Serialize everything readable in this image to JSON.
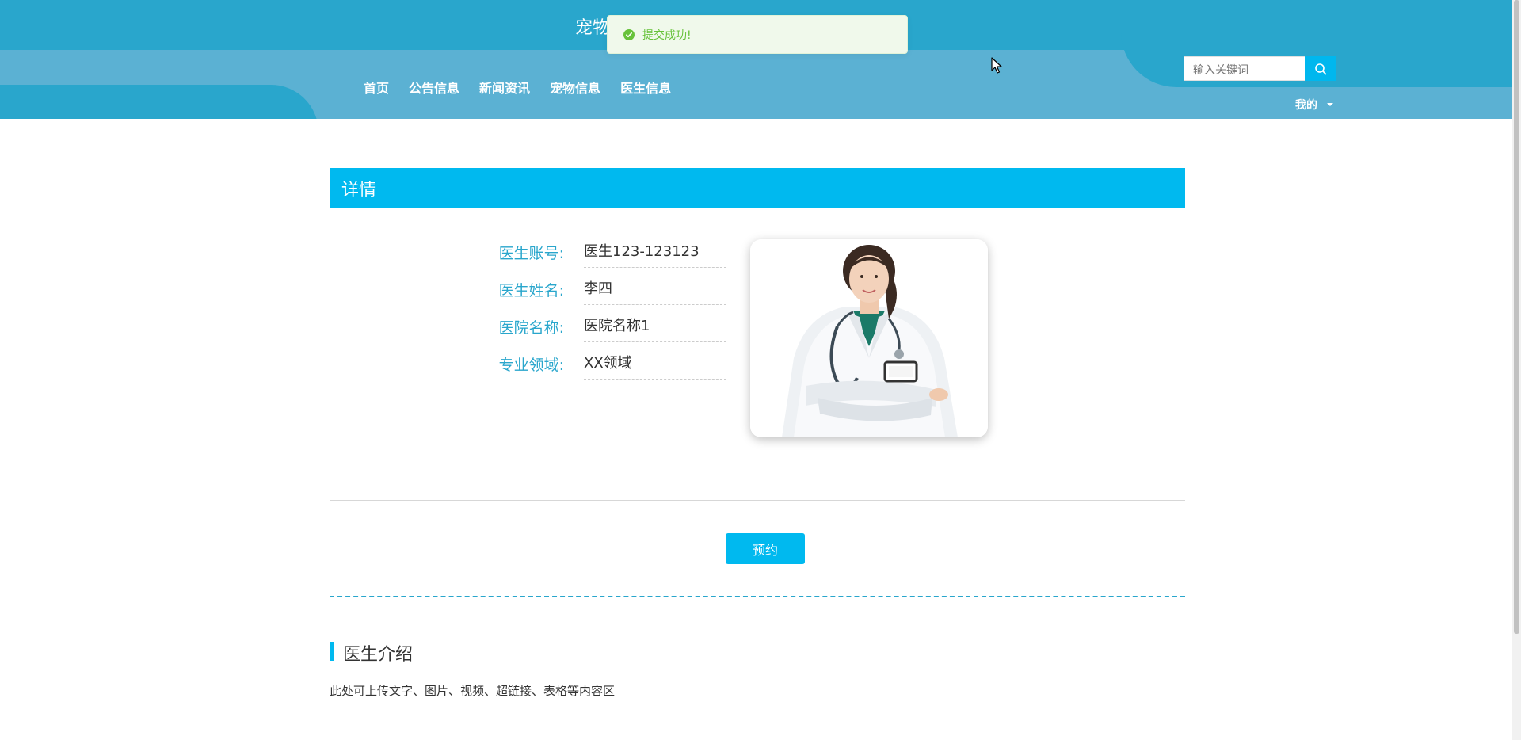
{
  "header": {
    "site_title": "宠物",
    "nav": [
      "首页",
      "公告信息",
      "新闻资讯",
      "宠物信息",
      "医生信息"
    ],
    "search": {
      "placeholder": "输入关键词"
    },
    "user_menu_label": "我的"
  },
  "toast": {
    "text": "提交成功!"
  },
  "detail": {
    "section_title": "详情",
    "fields": [
      {
        "label": "医生账号:",
        "value": "医生123-123123"
      },
      {
        "label": "医生姓名:",
        "value": "李四"
      },
      {
        "label": "医院名称:",
        "value": "医院名称1"
      },
      {
        "label": "专业领域:",
        "value": "XX领域"
      }
    ],
    "book_button": "预约"
  },
  "intro": {
    "title": "医生介绍",
    "text": "此处可上传文字、图片、视频、超链接、表格等内容区"
  },
  "colors": {
    "header_dark": "#29a6cc",
    "header_light": "#5bb1d3",
    "accent": "#00b9ef",
    "success": "#67c23a"
  }
}
